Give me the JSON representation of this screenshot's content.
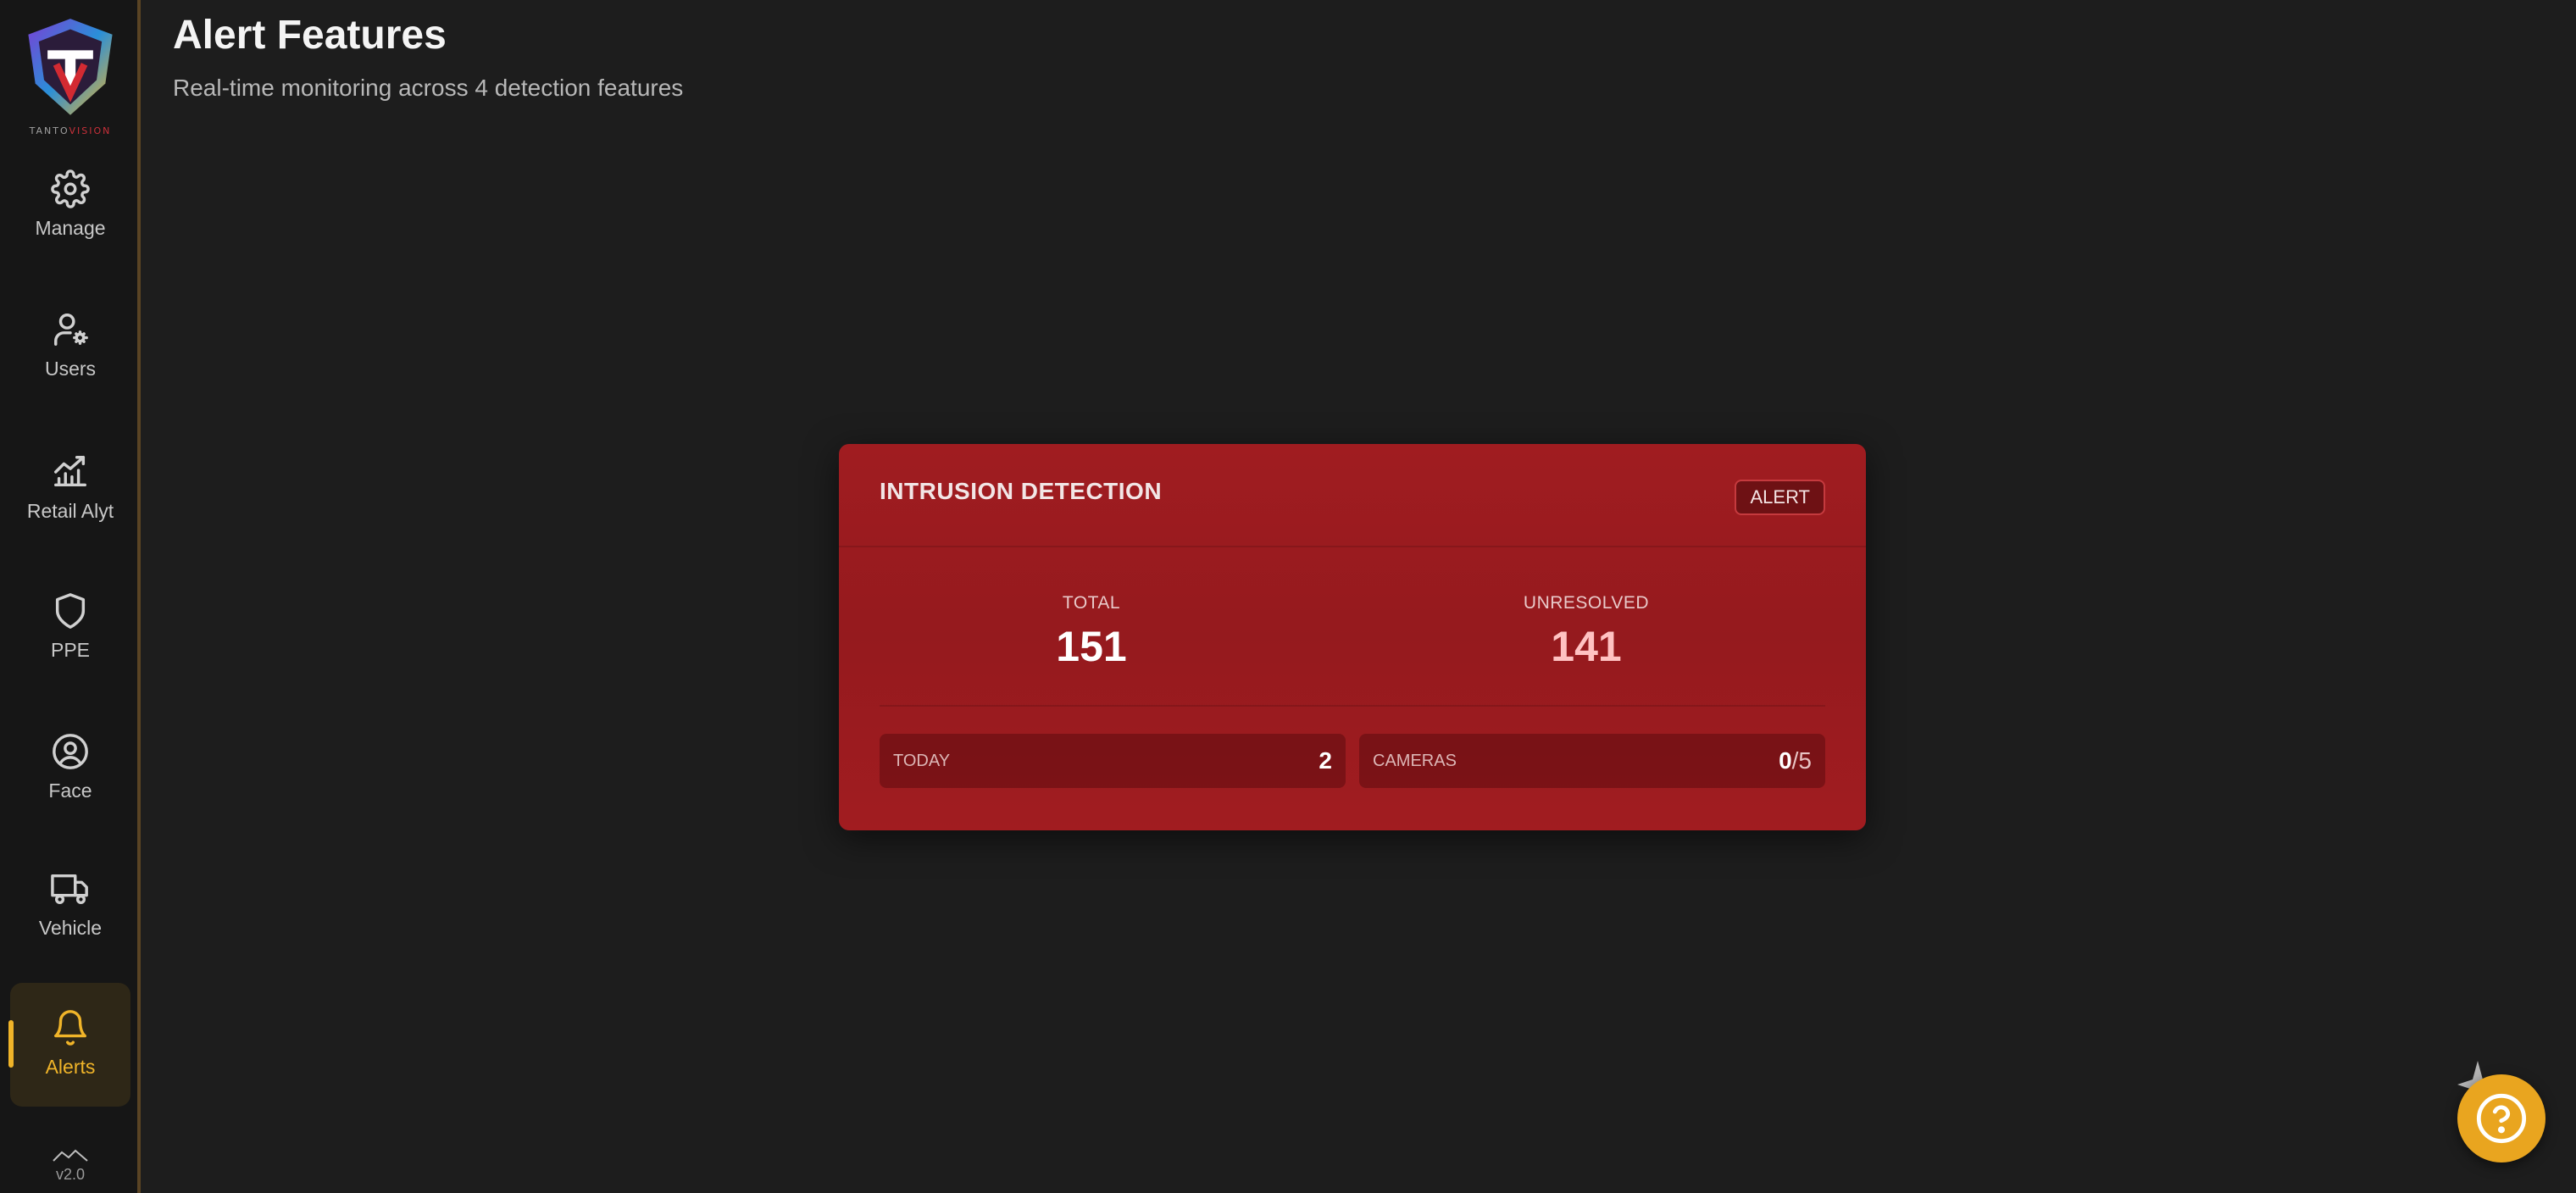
{
  "brand": {
    "logo_text_a": "TANTO",
    "logo_text_b": "VISION"
  },
  "sidebar": {
    "items": [
      {
        "label": "Manage",
        "icon": "gear-icon"
      },
      {
        "label": "Users",
        "icon": "user-settings-icon"
      },
      {
        "label": "Retail Alyt",
        "icon": "chart-icon"
      },
      {
        "label": "PPE",
        "icon": "shield-icon"
      },
      {
        "label": "Face",
        "icon": "face-icon"
      },
      {
        "label": "Vehicle",
        "icon": "truck-icon"
      },
      {
        "label": "Alerts",
        "icon": "bell-icon",
        "active": true
      }
    ],
    "version": "v2.0"
  },
  "header": {
    "title": "Alert Features",
    "subtitle": "Real-time monitoring across 4 detection features"
  },
  "card": {
    "title": "INTRUSION DETECTION",
    "badge": "ALERT",
    "total_label": "TOTAL",
    "total_value": "151",
    "unresolved_label": "UNRESOLVED",
    "unresolved_value": "141",
    "today_label": "TODAY",
    "today_value": "2",
    "cameras_label": "CAMERAS",
    "cameras_active": "0",
    "cameras_total": "/5"
  },
  "colors": {
    "accent": "#f0b429",
    "card": "#9a1b1f",
    "background": "#1d1d1d"
  }
}
